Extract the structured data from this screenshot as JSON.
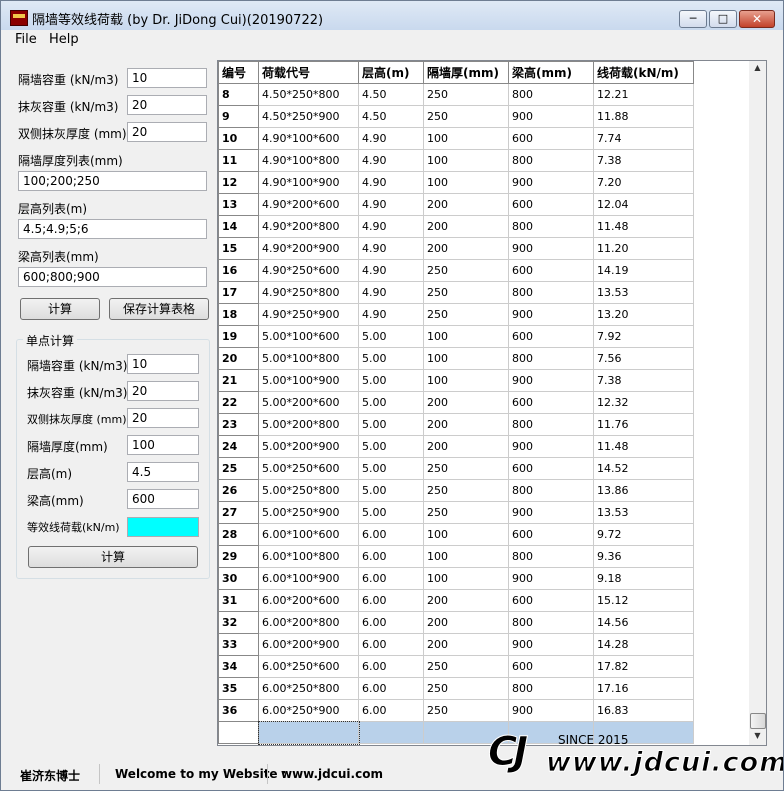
{
  "window": {
    "title": "隔墙等效线荷载 (by Dr. JiDong Cui)(20190722)"
  },
  "menu": {
    "file": "File",
    "help": "Help"
  },
  "batch": {
    "wall_density_label": "隔墙容重 (kN/m3)",
    "wall_density": "10",
    "plaster_density_label": "抹灰容重 (kN/m3)",
    "plaster_density": "20",
    "plaster_thickness_label": "双侧抹灰厚度 (mm)",
    "plaster_thickness": "20",
    "wall_thickness_list_label": "隔墙厚度列表(mm)",
    "wall_thickness_list": "100;200;250",
    "story_height_list_label": "层高列表(m)",
    "story_height_list": "4.5;4.9;5;6",
    "beam_height_list_label": "梁高列表(mm)",
    "beam_height_list": "600;800;900",
    "calc_button": "计算",
    "save_button": "保存计算表格"
  },
  "single": {
    "group_title": "单点计算",
    "wall_density_label": "隔墙容重 (kN/m3)",
    "wall_density": "10",
    "plaster_density_label": "抹灰容重 (kN/m3)",
    "plaster_density": "20",
    "plaster_thickness_label": "双侧抹灰厚度 (mm)",
    "plaster_thickness": "20",
    "wall_thickness_label": "隔墙厚度(mm)",
    "wall_thickness": "100",
    "story_height_label": "层高(m)",
    "story_height": "4.5",
    "beam_height_label": "梁高(mm)",
    "beam_height": "600",
    "result_label": "等效线荷载(kN/m)",
    "result": "",
    "calc_button": "计算",
    "result_color": "#00ffff"
  },
  "table": {
    "headers": [
      "编号",
      "荷载代号",
      "层高(m)",
      "隔墙厚(mm)",
      "梁高(mm)",
      "线荷载(kN/m)"
    ],
    "rows": [
      [
        "8",
        "4.50*250*800",
        "4.50",
        "250",
        "800",
        "12.21"
      ],
      [
        "9",
        "4.50*250*900",
        "4.50",
        "250",
        "900",
        "11.88"
      ],
      [
        "10",
        "4.90*100*600",
        "4.90",
        "100",
        "600",
        "7.74"
      ],
      [
        "11",
        "4.90*100*800",
        "4.90",
        "100",
        "800",
        "7.38"
      ],
      [
        "12",
        "4.90*100*900",
        "4.90",
        "100",
        "900",
        "7.20"
      ],
      [
        "13",
        "4.90*200*600",
        "4.90",
        "200",
        "600",
        "12.04"
      ],
      [
        "14",
        "4.90*200*800",
        "4.90",
        "200",
        "800",
        "11.48"
      ],
      [
        "15",
        "4.90*200*900",
        "4.90",
        "200",
        "900",
        "11.20"
      ],
      [
        "16",
        "4.90*250*600",
        "4.90",
        "250",
        "600",
        "14.19"
      ],
      [
        "17",
        "4.90*250*800",
        "4.90",
        "250",
        "800",
        "13.53"
      ],
      [
        "18",
        "4.90*250*900",
        "4.90",
        "250",
        "900",
        "13.20"
      ],
      [
        "19",
        "5.00*100*600",
        "5.00",
        "100",
        "600",
        "7.92"
      ],
      [
        "20",
        "5.00*100*800",
        "5.00",
        "100",
        "800",
        "7.56"
      ],
      [
        "21",
        "5.00*100*900",
        "5.00",
        "100",
        "900",
        "7.38"
      ],
      [
        "22",
        "5.00*200*600",
        "5.00",
        "200",
        "600",
        "12.32"
      ],
      [
        "23",
        "5.00*200*800",
        "5.00",
        "200",
        "800",
        "11.76"
      ],
      [
        "24",
        "5.00*200*900",
        "5.00",
        "200",
        "900",
        "11.48"
      ],
      [
        "25",
        "5.00*250*600",
        "5.00",
        "250",
        "600",
        "14.52"
      ],
      [
        "26",
        "5.00*250*800",
        "5.00",
        "250",
        "800",
        "13.86"
      ],
      [
        "27",
        "5.00*250*900",
        "5.00",
        "250",
        "900",
        "13.53"
      ],
      [
        "28",
        "6.00*100*600",
        "6.00",
        "100",
        "600",
        "9.72"
      ],
      [
        "29",
        "6.00*100*800",
        "6.00",
        "100",
        "800",
        "9.36"
      ],
      [
        "30",
        "6.00*100*900",
        "6.00",
        "100",
        "900",
        "9.18"
      ],
      [
        "31",
        "6.00*200*600",
        "6.00",
        "200",
        "600",
        "15.12"
      ],
      [
        "32",
        "6.00*200*800",
        "6.00",
        "200",
        "800",
        "14.56"
      ],
      [
        "33",
        "6.00*200*900",
        "6.00",
        "200",
        "900",
        "14.28"
      ],
      [
        "34",
        "6.00*250*600",
        "6.00",
        "250",
        "600",
        "17.82"
      ],
      [
        "35",
        "6.00*250*800",
        "6.00",
        "250",
        "800",
        "17.16"
      ],
      [
        "36",
        "6.00*250*900",
        "6.00",
        "250",
        "900",
        "16.83"
      ]
    ],
    "selected_row_color": "#b9d1ea"
  },
  "status": {
    "author": "崔济东博士",
    "welcome": "Welcome to my Website :",
    "url": "www.jdcui.com"
  },
  "logo": {
    "mark": "CJ",
    "since": "SINCE 2015",
    "url": "www.jdcui.com"
  },
  "icons": {
    "app": "app-logo-icon",
    "minimize": "minimize-icon",
    "maximize": "maximize-icon",
    "close": "close-icon",
    "scroll_up": "scroll-up-arrow-icon",
    "scroll_down": "scroll-down-arrow-icon"
  }
}
